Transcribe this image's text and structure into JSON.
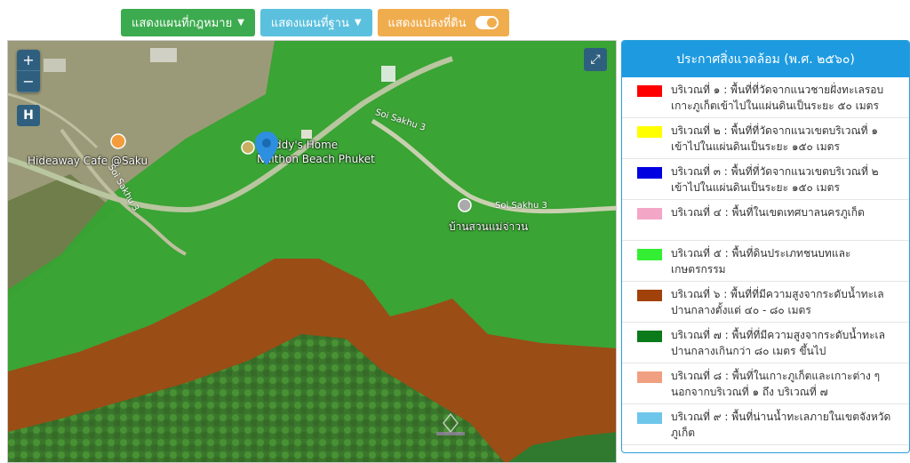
{
  "toolbar": {
    "btn_legal": {
      "label": "แสดงแผนที่กฎหมาย",
      "color": "#3cab4f"
    },
    "btn_base": {
      "label": "แสดงแผนที่ฐาน",
      "color": "#5bc0de"
    },
    "btn_parcel": {
      "label": "แสดงแปลงที่ดิน",
      "color": "#f0ad4e"
    }
  },
  "map": {
    "zoom_in": "+",
    "zoom_out": "−",
    "home_button": "H",
    "places": {
      "cafe": "Hideaway Cafe @Saku",
      "home_line1": "ddy's Home",
      "home_line2": "Naithon Beach Phuket",
      "village": "บ้านสวนแม่จ่าวน",
      "road1": "Soi Sakhu 3",
      "road2": "Soi Sakhu 3",
      "road3": "Soi Sakhu 3"
    }
  },
  "legend": {
    "title": "ประกาศสิ่งแวดล้อม (พ.ศ. ๒๕๖๐)",
    "items": [
      {
        "color": "#ff0000",
        "text": "บริเวณที่ ๑ : พื้นที่ที่วัดจากแนวชายฝั่งทะเลรอบเกาะภูเก็ตเข้าไปในแผ่นดินเป็นระยะ ๕๐ เมตร"
      },
      {
        "color": "#ffff00",
        "text": "บริเวณที่ ๒ : พื้นที่ที่วัดจากแนวเขตบริเวณที่ ๑ เข้าไปในแผ่นดินเป็นระยะ ๑๕๐ เมตร"
      },
      {
        "color": "#0000e0",
        "text": "บริเวณที่ ๓ : พื้นที่ที่วัดจากแนวเขตบริเวณที่ ๒ เข้าไปในแผ่นดินเป็นระยะ ๑๕๐ เมตร"
      },
      {
        "color": "#f4a6c7",
        "text": "บริเวณที่ ๔ : พื้นที่ในเขตเทศบาลนครภูเก็ต"
      },
      {
        "color": "#33ee33",
        "text": "บริเวณที่ ๕ : พื้นที่ดินประเภทชนบทและเกษตรกรรม"
      },
      {
        "color": "#a0420a",
        "text": "บริเวณที่ ๖ : พื้นที่ที่มีความสูงจากระดับน้ำทะเลปานกลางตั้งแต่ ๔๐ - ๘๐ เมตร"
      },
      {
        "color": "#0a7a1a",
        "text": "บริเวณที่ ๗ : พื้นที่ที่มีความสูงจากระดับน้ำทะเลปานกลางเกินกว่า ๘๐ เมตร ขึ้นไป"
      },
      {
        "color": "#f0a080",
        "text": "บริเวณที่ ๘ : พื้นที่ในเกาะภูเก็ตและเกาะต่าง ๆ นอกจากบริเวณที่ ๑ ถึง บริเวณที่ ๗"
      },
      {
        "color": "#6ec6ea",
        "text": "บริเวณที่ ๙ : พื้นที่น่านน้ำทะเลภายในเขตจังหวัดภูเก็ต"
      }
    ]
  }
}
